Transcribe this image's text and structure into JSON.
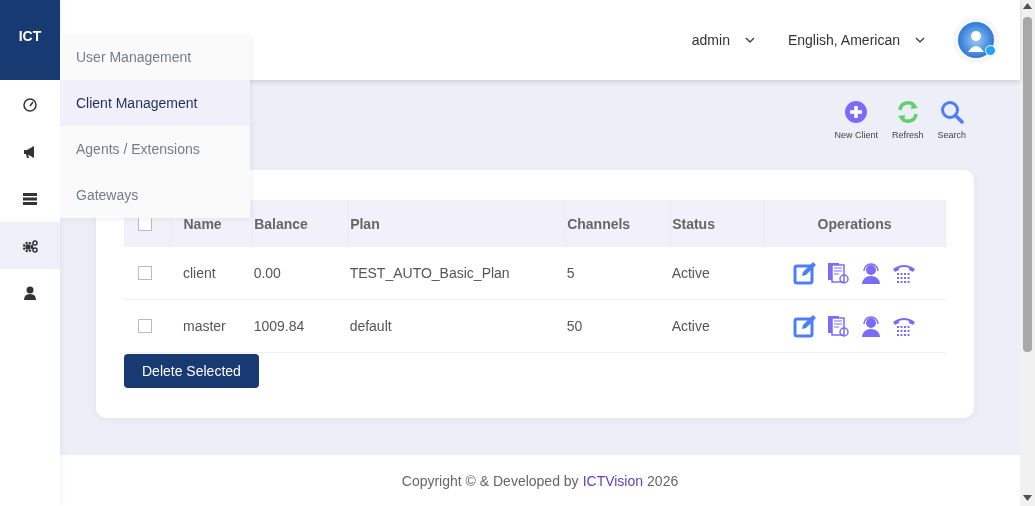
{
  "logo": "ICT",
  "sidebar": {
    "items": [
      {
        "selected": false
      },
      {
        "selected": false
      },
      {
        "selected": false
      },
      {
        "selected": true
      },
      {
        "selected": false
      }
    ]
  },
  "submenu": [
    {
      "label": "User Management",
      "selected": false
    },
    {
      "label": "Client Management",
      "selected": true
    },
    {
      "label": "Agents / Extensions",
      "selected": false
    },
    {
      "label": "Gateways",
      "selected": false
    }
  ],
  "header": {
    "user": "admin",
    "language": "English, American",
    "online": true
  },
  "toolbar": [
    {
      "kind": "add",
      "label": "New Client"
    },
    {
      "kind": "refresh",
      "label": "Refresh"
    },
    {
      "kind": "search",
      "label": "Search"
    }
  ],
  "table": {
    "select_all": {
      "checked": false
    },
    "columns": [
      "Name",
      "Balance",
      "Plan",
      "Channels",
      "Status",
      "Operations"
    ],
    "rows": [
      {
        "checked": false,
        "cells": [
          "client",
          "0.00",
          "TEST_AUTO_Basic_Plan",
          "5",
          "Active"
        ]
      },
      {
        "checked": false,
        "cells": [
          "master",
          "1009.84",
          "default",
          "50",
          "Active"
        ]
      }
    ]
  },
  "delete_button": "Delete Selected",
  "footer": {
    "text": "Copyright © & Developed by",
    "link": "ICTVision",
    "year": "2026"
  }
}
